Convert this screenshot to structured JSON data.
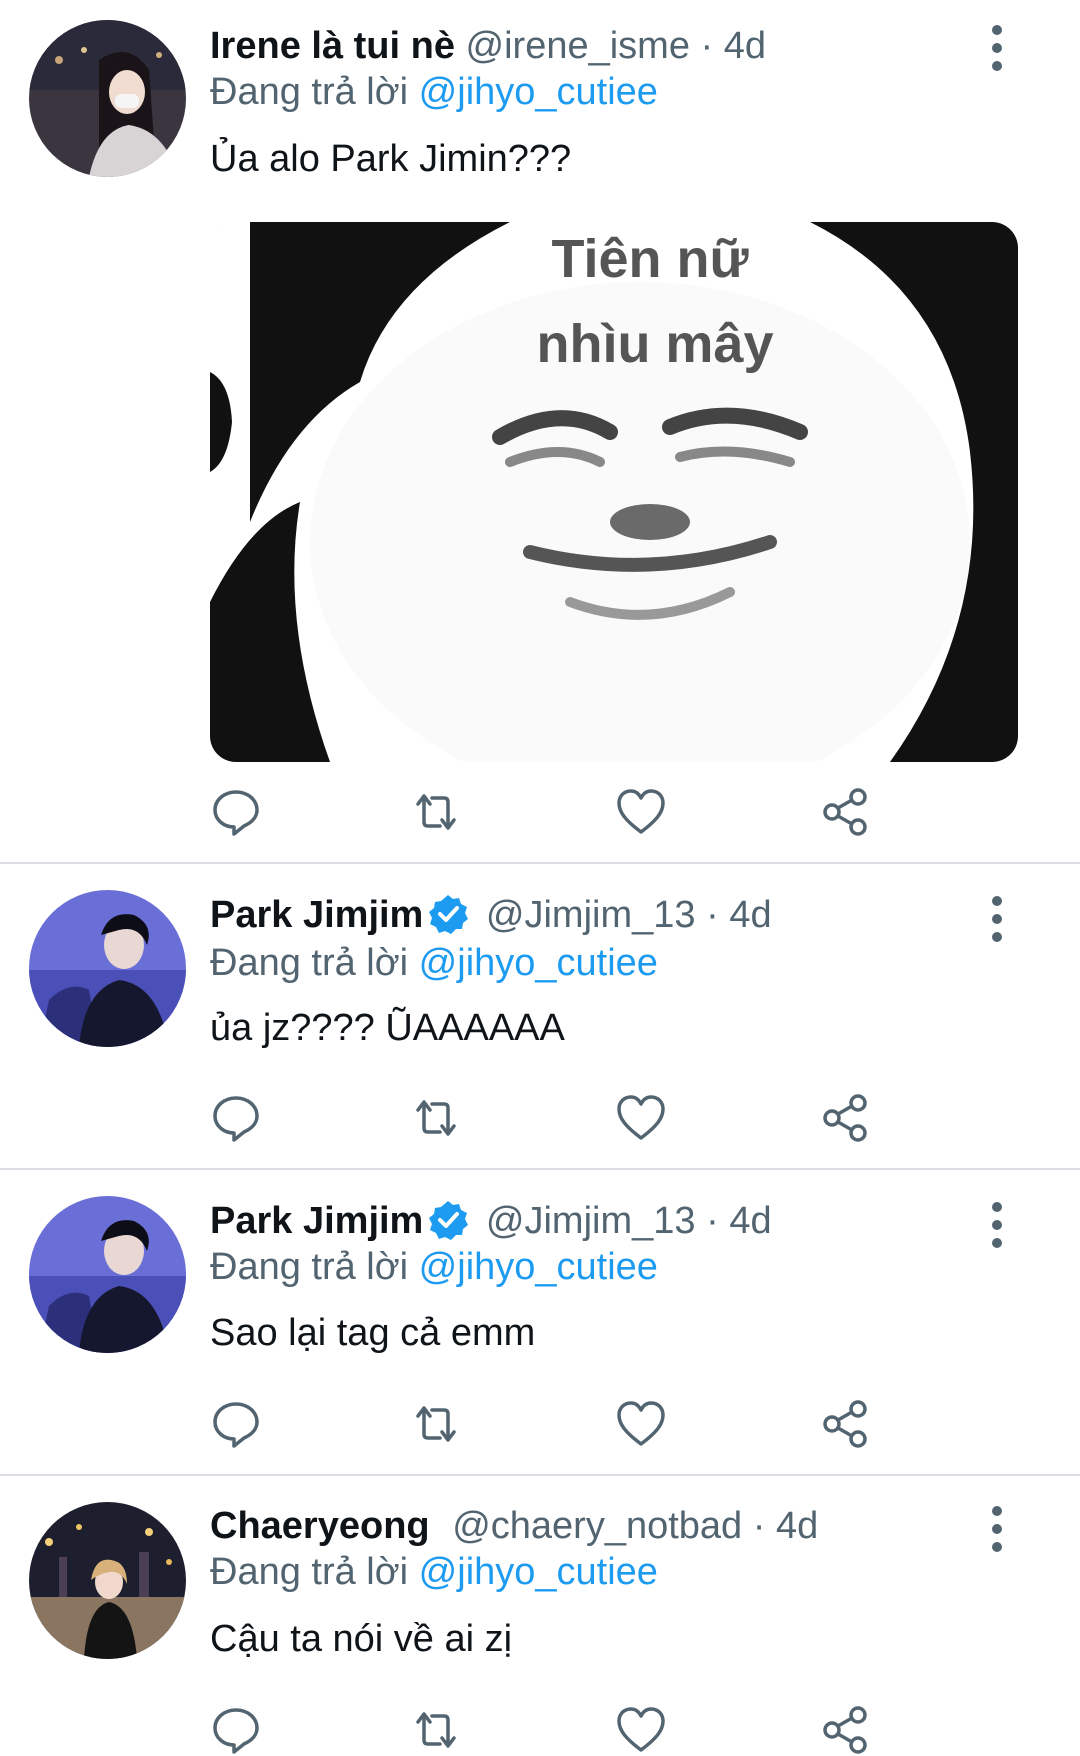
{
  "tweets": [
    {
      "name": "Irene là tui nè",
      "handle": "@irene_isme",
      "separator": "·",
      "time": "4d",
      "reply_prefix": "Đang trả lời",
      "mention": "@jihyo_cutiee",
      "text": "Ủa alo Park Jimin???",
      "verified": false,
      "media": {
        "line1": "Tiên nữ",
        "line2": "nhìu mây"
      }
    },
    {
      "name": "Park Jimjim",
      "handle": "@Jimjim_13",
      "separator": "·",
      "time": "4d",
      "reply_prefix": "Đang trả lời",
      "mention": "@jihyo_cutiee",
      "text": "ủa jz???? ŨAAAAAA",
      "verified": true
    },
    {
      "name": "Park Jimjim",
      "handle": "@Jimjim_13",
      "separator": "·",
      "time": "4d",
      "reply_prefix": "Đang trả lời",
      "mention": "@jihyo_cutiee",
      "text": "Sao lại tag cả emm",
      "verified": true
    },
    {
      "name": "Chaeryeong",
      "handle": "@chaery_notbad",
      "separator": "·",
      "time": "4d",
      "reply_prefix": "Đang trả lời",
      "mention": "@jihyo_cutiee",
      "text": "Cậu ta nói về ai zị",
      "verified": false
    }
  ],
  "icons": {
    "reply": "reply-icon",
    "retweet": "retweet-icon",
    "like": "heart-icon",
    "share": "share-icon",
    "more": "more-vertical-icon",
    "verified": "verified-badge-icon"
  },
  "colors": {
    "link": "#1d9bf0",
    "secondary_text": "#536471",
    "primary_text": "#0f1419",
    "divider": "#dadde1"
  }
}
